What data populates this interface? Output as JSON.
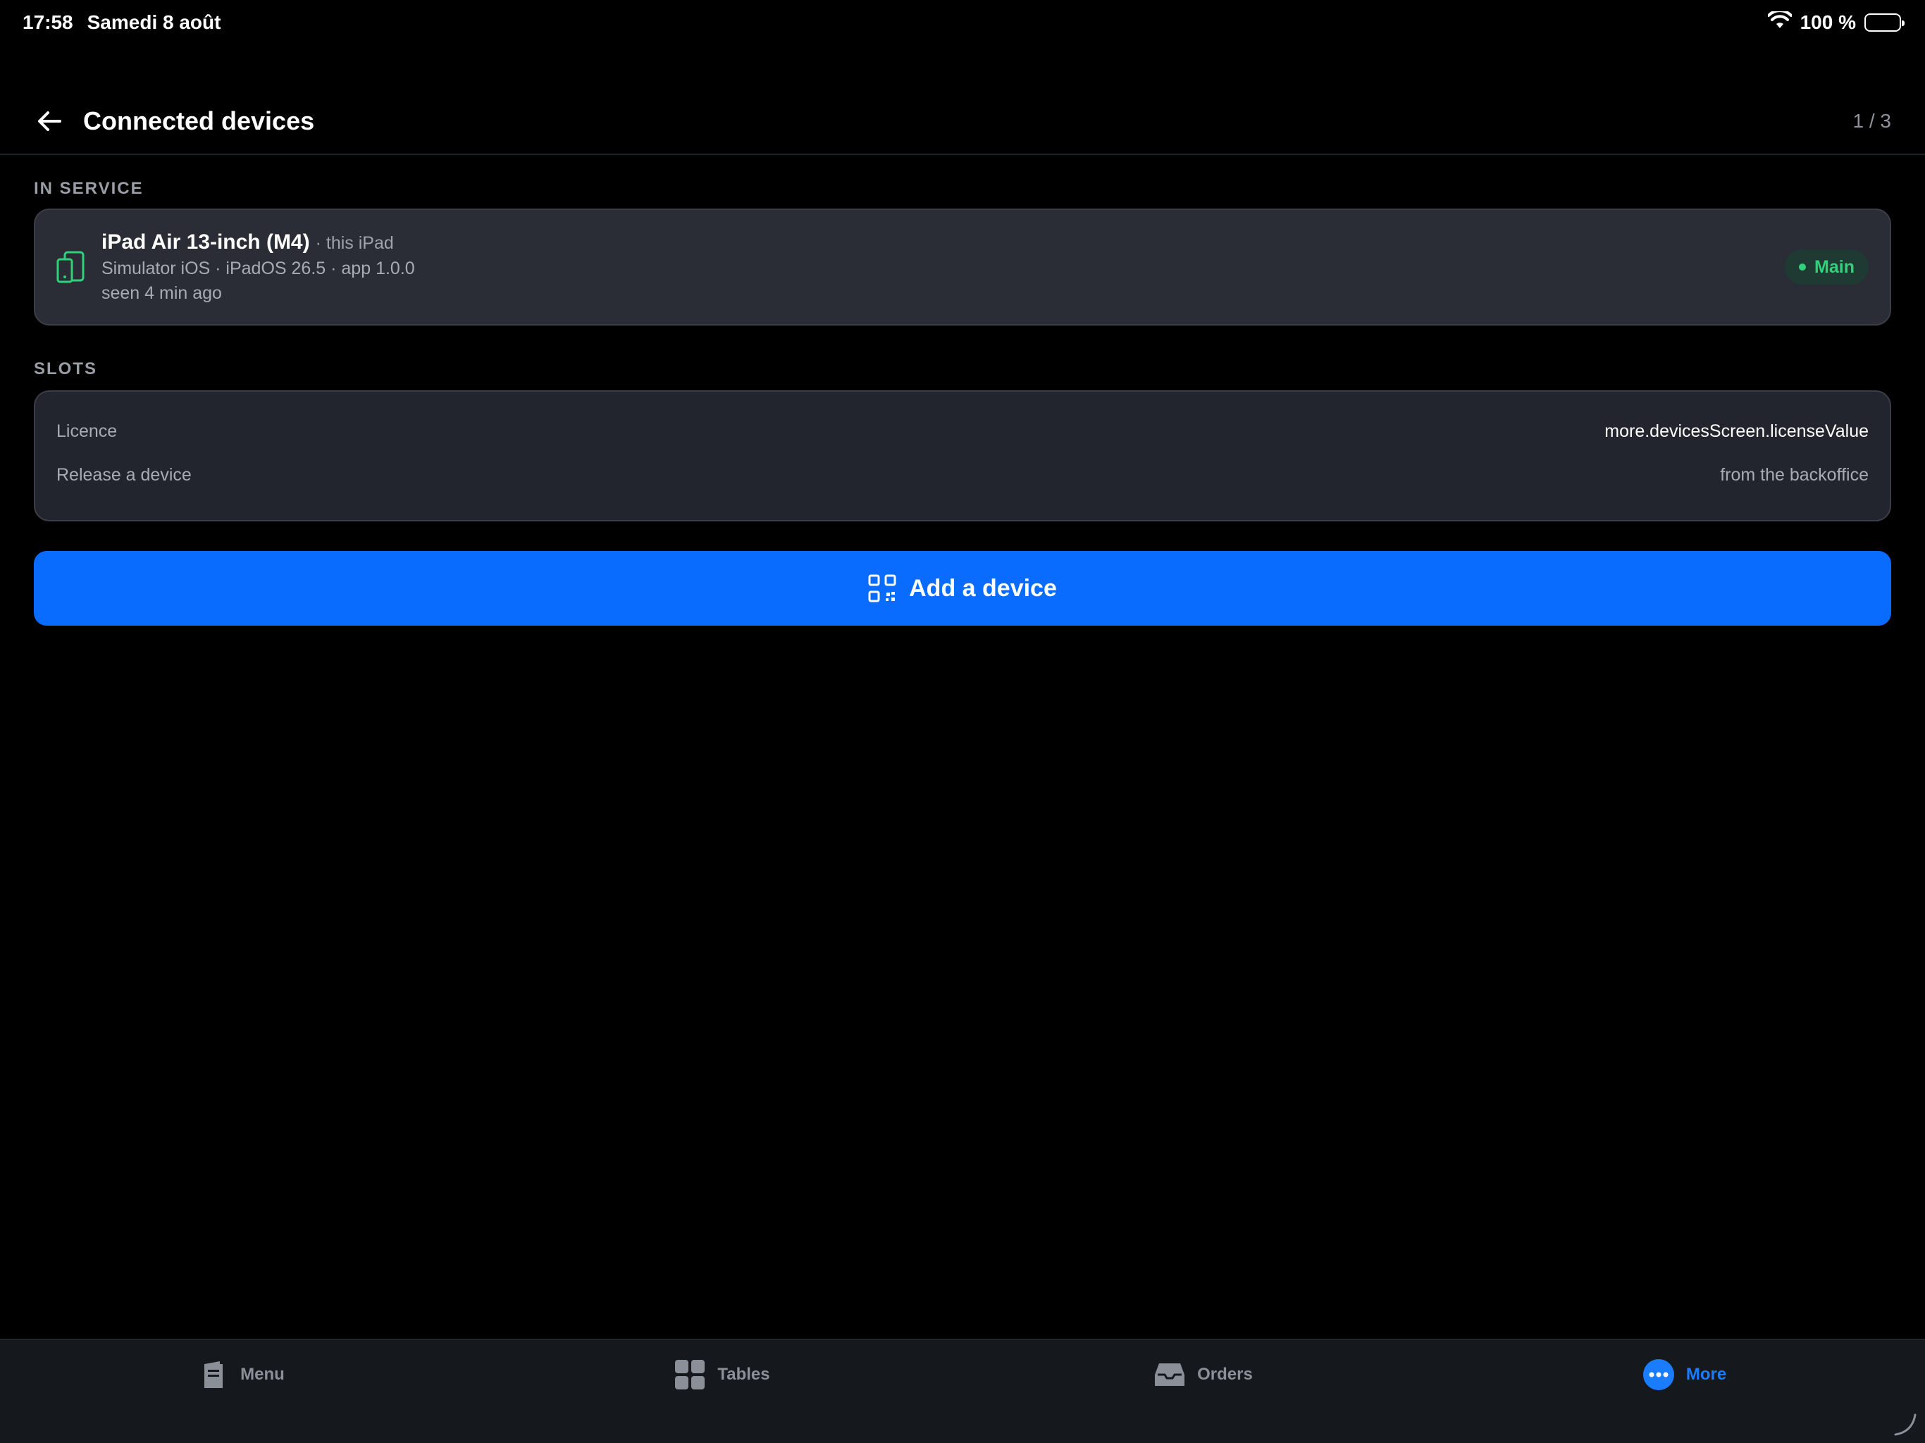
{
  "status_bar": {
    "time": "17:58",
    "date": "Samedi 8 août",
    "battery": "100 %",
    "icons": [
      "wifi-icon",
      "battery-icon"
    ]
  },
  "header": {
    "title": "Connected devices",
    "counter": "1 / 3",
    "back_icon": "arrow-left-icon"
  },
  "in_service": {
    "label": "IN SERVICE",
    "device": {
      "name": "iPad Air 13-inch (M4)",
      "suffix": "· this iPad",
      "meta": "Simulator iOS · iPadOS 26.5 · app 1.0.0",
      "seen": "seen 4 min ago",
      "badge": "Main",
      "icon": "tablet-phone-icon"
    }
  },
  "slots": {
    "label": "SLOTS",
    "rows": [
      {
        "label": "Licence",
        "value": "more.devicesScreen.licenseValue"
      },
      {
        "label": "Release a device",
        "value": "from the backoffice"
      }
    ]
  },
  "add_device": {
    "label": "Add a device",
    "icon": "qr-code-icon"
  },
  "tabbar": {
    "tabs": [
      {
        "label": "Menu",
        "icon": "menu-book-icon"
      },
      {
        "label": "Tables",
        "icon": "grid-icon"
      },
      {
        "label": "Orders",
        "icon": "inbox-icon"
      },
      {
        "label": "More",
        "icon": "more-dots-icon"
      }
    ],
    "active": "More"
  },
  "colors": {
    "background": "#000000",
    "card": "#2a2d36",
    "accent": "#0a6cff",
    "success": "#2fd27a",
    "muted_text": "#a7abb3"
  }
}
